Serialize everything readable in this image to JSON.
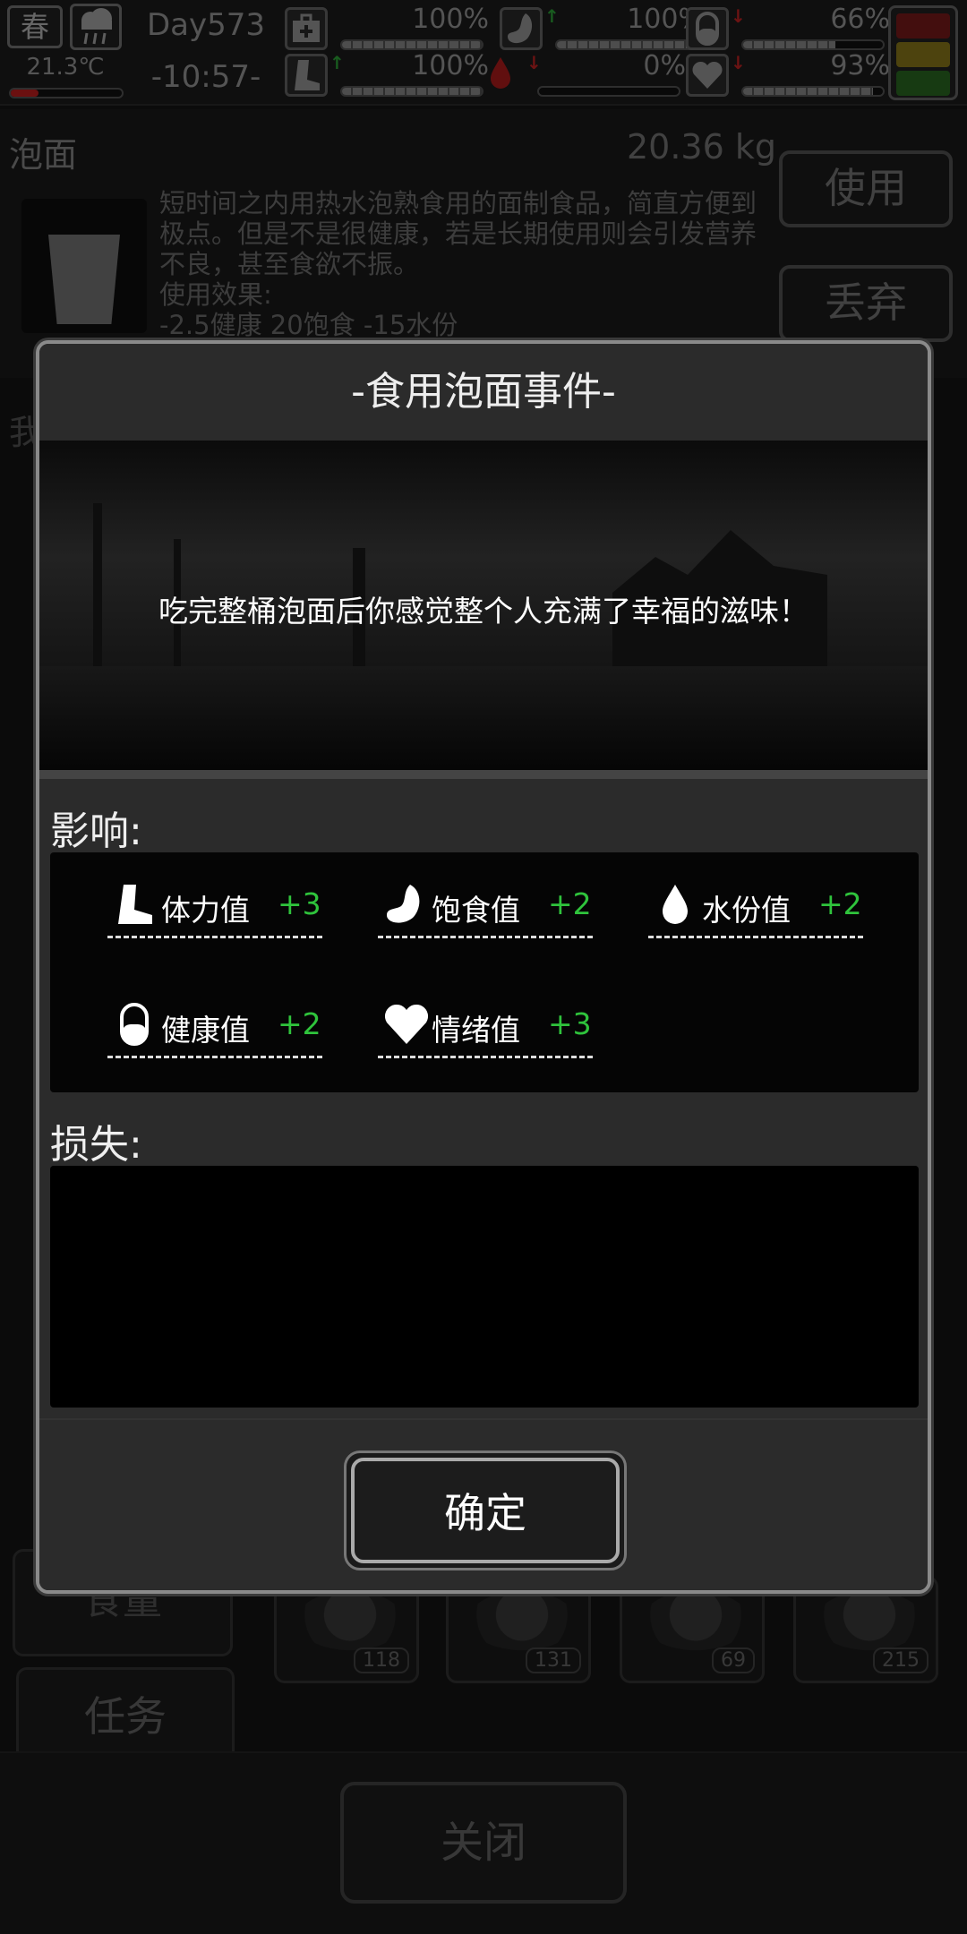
{
  "status": {
    "season": "春",
    "temperature": "21.3℃",
    "temperature_level": 0.25,
    "day": "Day573",
    "time": "-10:57-",
    "stats": [
      {
        "name": "health-kit",
        "percent": "100%",
        "level": 1.0,
        "arrow": ""
      },
      {
        "name": "stomach",
        "percent": "100%",
        "level": 1.0,
        "arrow": "up"
      },
      {
        "name": "pill",
        "percent": "66%",
        "level": 0.66,
        "arrow": "down"
      },
      {
        "name": "boot",
        "percent": "100%",
        "level": 1.0,
        "arrow": "up"
      },
      {
        "name": "water-drop",
        "percent": "0%",
        "level": 0.0,
        "arrow": "down"
      },
      {
        "name": "heart",
        "percent": "93%",
        "level": 0.93,
        "arrow": "down"
      }
    ],
    "traffic_colors": [
      "#7a1a1a",
      "#8c7a1a",
      "#2a6a22"
    ]
  },
  "item": {
    "name": "泡面",
    "weight": "20.36 kg",
    "description": "短时间之内用热水泡熟食用的面制食品，简直方便到极点。但是不是很健康，若是长期使用则会引发营养不良，甚至食欲不振。",
    "effect_title": "使用效果:",
    "effect_values": "-2.5健康 20饱食 -15水份",
    "use_label": "使用",
    "discard_label": "丢弃",
    "partial_label": "我"
  },
  "background": {
    "food_label": "食量",
    "tasks_label": "任务",
    "close_label": "关闭",
    "counts": [
      "118",
      "131",
      "69",
      "215"
    ]
  },
  "dialog": {
    "title": "-食用泡面事件-",
    "message": "吃完整桶泡面后你感觉整个人充满了幸福的滋味！",
    "effects_label": "影响:",
    "loss_label": "损失:",
    "effects": [
      {
        "label": "体力值",
        "value": "+3",
        "icon": "boot-icon"
      },
      {
        "label": "饱食值",
        "value": "+2",
        "icon": "stomach-icon"
      },
      {
        "label": "水份值",
        "value": "+2",
        "icon": "water-drop-icon"
      },
      {
        "label": "健康值",
        "value": "+2",
        "icon": "pill-icon"
      },
      {
        "label": "情绪值",
        "value": "+3",
        "icon": "heart-icon"
      }
    ],
    "confirm_label": "确定"
  },
  "colors": {
    "positive": "#2fc43c",
    "negative": "#c52424",
    "temp_bar": "#c41e1e"
  }
}
